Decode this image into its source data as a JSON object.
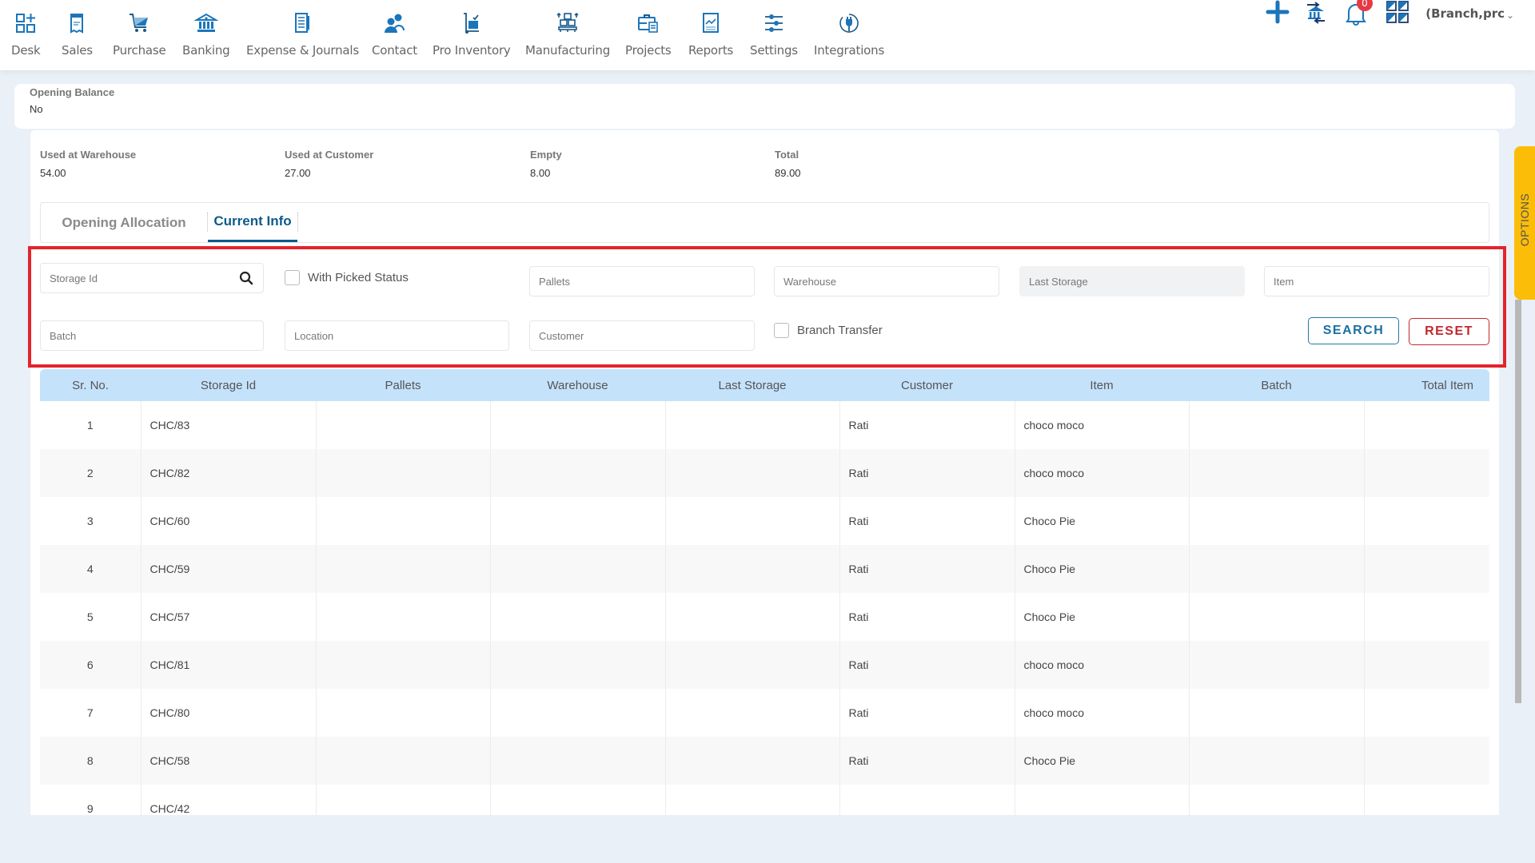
{
  "nav": {
    "items": [
      {
        "label": "Desk",
        "icon": "desk-grid-icon"
      },
      {
        "label": "Sales",
        "icon": "receipt-icon"
      },
      {
        "label": "Purchase",
        "icon": "cart-icon"
      },
      {
        "label": "Banking",
        "icon": "bank-icon"
      },
      {
        "label": "Expense & Journals",
        "icon": "notebook-icon"
      },
      {
        "label": "Contact",
        "icon": "contacts-icon"
      },
      {
        "label": "Pro Inventory",
        "icon": "trolley-icon"
      },
      {
        "label": "Manufacturing",
        "icon": "pallet-boxes-icon"
      },
      {
        "label": "Projects",
        "icon": "briefcase-icon"
      },
      {
        "label": "Reports",
        "icon": "report-chart-icon"
      },
      {
        "label": "Settings",
        "icon": "sliders-icon"
      },
      {
        "label": "Integrations",
        "icon": "plug-icon"
      }
    ],
    "notification_count": "0",
    "user_label": "m(Branch,prc",
    "accent": "#1b75bb"
  },
  "opening_balance": {
    "label": "Opening Balance",
    "value": "No"
  },
  "stats": [
    {
      "label": "Used at Warehouse",
      "value": "54.00"
    },
    {
      "label": "Used at Customer",
      "value": "27.00"
    },
    {
      "label": "Empty",
      "value": "8.00"
    },
    {
      "label": "Total",
      "value": "89.00"
    }
  ],
  "tabs": [
    {
      "label": "Opening Allocation",
      "active": false
    },
    {
      "label": "Current Info",
      "active": true
    }
  ],
  "filters": {
    "storage_id": {
      "placeholder": "Storage Id",
      "value": ""
    },
    "with_picked_status": {
      "label": "With Picked Status",
      "checked": false
    },
    "pallets": {
      "placeholder": "Pallets",
      "value": ""
    },
    "warehouse": {
      "placeholder": "Warehouse",
      "value": ""
    },
    "last_storage": {
      "placeholder": "Last Storage",
      "value": ""
    },
    "item": {
      "placeholder": "Item",
      "value": ""
    },
    "batch": {
      "placeholder": "Batch",
      "value": ""
    },
    "location": {
      "placeholder": "Location",
      "value": ""
    },
    "customer": {
      "placeholder": "Customer",
      "value": ""
    },
    "branch_transfer": {
      "label": "Branch Transfer",
      "checked": false
    },
    "search_label": "SEARCH",
    "reset_label": "RESET"
  },
  "table": {
    "columns": [
      "Sr. No.",
      "Storage Id",
      "Pallets",
      "Warehouse",
      "Last Storage",
      "Customer",
      "Item",
      "Batch",
      "Total Item"
    ],
    "rows": [
      [
        "1",
        "CHC/83",
        "",
        "",
        "",
        "Rati",
        "choco moco",
        "",
        ""
      ],
      [
        "2",
        "CHC/82",
        "",
        "",
        "",
        "Rati",
        "choco moco",
        "",
        ""
      ],
      [
        "3",
        "CHC/60",
        "",
        "",
        "",
        "Rati",
        "Choco Pie",
        "",
        ""
      ],
      [
        "4",
        "CHC/59",
        "",
        "",
        "",
        "Rati",
        "Choco Pie",
        "",
        ""
      ],
      [
        "5",
        "CHC/57",
        "",
        "",
        "",
        "Rati",
        "Choco Pie",
        "",
        ""
      ],
      [
        "6",
        "CHC/81",
        "",
        "",
        "",
        "Rati",
        "choco moco",
        "",
        ""
      ],
      [
        "7",
        "CHC/80",
        "",
        "",
        "",
        "Rati",
        "choco moco",
        "",
        ""
      ],
      [
        "8",
        "CHC/58",
        "",
        "",
        "",
        "Rati",
        "Choco Pie",
        "",
        ""
      ],
      [
        "9",
        "CHC/42",
        "",
        "",
        "",
        "",
        "",
        "",
        ""
      ]
    ]
  },
  "options_tab": {
    "label": "OPTIONS",
    "color": "#fbbd08"
  }
}
